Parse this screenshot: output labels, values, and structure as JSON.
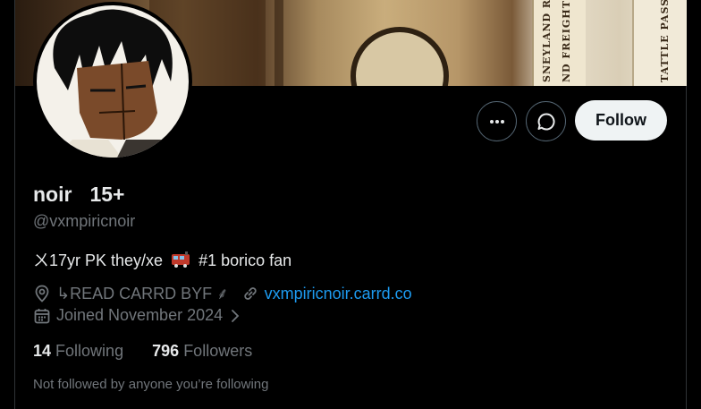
{
  "profile": {
    "name": "noir",
    "age_tag": "15+",
    "handle": "@vxmpiricnoir",
    "bio_before": "ㄨ17yr PK they/xe",
    "bio_after": "#1 borico fan",
    "location": "↳READ CARRD BYF ⸙",
    "website": "vxmpiricnoir.carrd.co",
    "joined": "Joined November 2024",
    "following_count": "14",
    "following_label": "Following",
    "followers_count": "796",
    "followers_label": "Followers",
    "mutuals_note": "Not followed by anyone you’re following"
  },
  "actions": {
    "follow_label": "Follow"
  },
  "banner": {
    "ticket_text_1": "SNEYLAND RR",
    "ticket_text_2": "ND FREIGHT",
    "ticket_text_3": "TATTLE PASSA"
  },
  "icons": {
    "more": "more-dots-icon",
    "message": "message-bubble-icon",
    "location": "location-pin-icon",
    "link": "link-icon",
    "calendar": "calendar-icon",
    "chevron": "chevron-right-icon",
    "train": "train-emoji"
  },
  "colors": {
    "background": "#000000",
    "text_primary": "#e7e9ea",
    "text_secondary": "#71767b",
    "link": "#1d9bf0",
    "follow_button_bg": "#eff3f4"
  }
}
